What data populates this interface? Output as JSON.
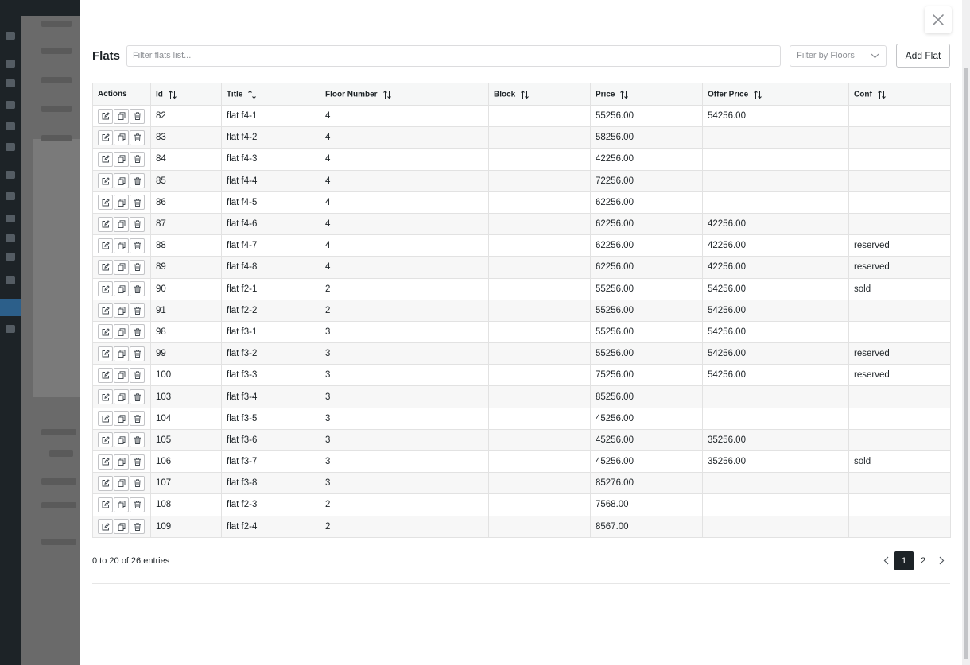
{
  "modal": {
    "title": "Flats",
    "filter_placeholder": "Filter flats list...",
    "floor_filter_label": "Filter by Floors",
    "add_button": "Add Flat"
  },
  "table": {
    "columns": [
      "Actions",
      "Id",
      "Title",
      "Floor Number",
      "Block",
      "Price",
      "Offer Price",
      "Conf"
    ],
    "rows": [
      {
        "id": "82",
        "title": "flat f4-1",
        "floor": "4",
        "block": "",
        "price": "55256.00",
        "offer": "54256.00",
        "conf": ""
      },
      {
        "id": "83",
        "title": "flat f4-2",
        "floor": "4",
        "block": "",
        "price": "58256.00",
        "offer": "",
        "conf": ""
      },
      {
        "id": "84",
        "title": "flat f4-3",
        "floor": "4",
        "block": "",
        "price": "42256.00",
        "offer": "",
        "conf": ""
      },
      {
        "id": "85",
        "title": "flat f4-4",
        "floor": "4",
        "block": "",
        "price": "72256.00",
        "offer": "",
        "conf": ""
      },
      {
        "id": "86",
        "title": "flat f4-5",
        "floor": "4",
        "block": "",
        "price": "62256.00",
        "offer": "",
        "conf": ""
      },
      {
        "id": "87",
        "title": "flat f4-6",
        "floor": "4",
        "block": "",
        "price": "62256.00",
        "offer": "42256.00",
        "conf": ""
      },
      {
        "id": "88",
        "title": "flat f4-7",
        "floor": "4",
        "block": "",
        "price": "62256.00",
        "offer": "42256.00",
        "conf": "reserved"
      },
      {
        "id": "89",
        "title": "flat f4-8",
        "floor": "4",
        "block": "",
        "price": "62256.00",
        "offer": "42256.00",
        "conf": "reserved"
      },
      {
        "id": "90",
        "title": "flat f2-1",
        "floor": "2",
        "block": "",
        "price": "55256.00",
        "offer": "54256.00",
        "conf": "sold"
      },
      {
        "id": "91",
        "title": "flat f2-2",
        "floor": "2",
        "block": "",
        "price": "55256.00",
        "offer": "54256.00",
        "conf": ""
      },
      {
        "id": "98",
        "title": "flat f3-1",
        "floor": "3",
        "block": "",
        "price": "55256.00",
        "offer": "54256.00",
        "conf": ""
      },
      {
        "id": "99",
        "title": "flat f3-2",
        "floor": "3",
        "block": "",
        "price": "55256.00",
        "offer": "54256.00",
        "conf": "reserved"
      },
      {
        "id": "100",
        "title": "flat f3-3",
        "floor": "3",
        "block": "",
        "price": "75256.00",
        "offer": "54256.00",
        "conf": "reserved"
      },
      {
        "id": "103",
        "title": "flat f3-4",
        "floor": "3",
        "block": "",
        "price": "85256.00",
        "offer": "",
        "conf": ""
      },
      {
        "id": "104",
        "title": "flat f3-5",
        "floor": "3",
        "block": "",
        "price": "45256.00",
        "offer": "",
        "conf": ""
      },
      {
        "id": "105",
        "title": "flat f3-6",
        "floor": "3",
        "block": "",
        "price": "45256.00",
        "offer": "35256.00",
        "conf": ""
      },
      {
        "id": "106",
        "title": "flat f3-7",
        "floor": "3",
        "block": "",
        "price": "45256.00",
        "offer": "35256.00",
        "conf": "sold"
      },
      {
        "id": "107",
        "title": "flat f3-8",
        "floor": "3",
        "block": "",
        "price": "85276.00",
        "offer": "",
        "conf": ""
      },
      {
        "id": "108",
        "title": "flat f2-3",
        "floor": "2",
        "block": "",
        "price": "7568.00",
        "offer": "",
        "conf": ""
      },
      {
        "id": "109",
        "title": "flat f2-4",
        "floor": "2",
        "block": "",
        "price": "8567.00",
        "offer": "",
        "conf": ""
      }
    ]
  },
  "footer": {
    "entries_text": "0 to 20 of 26 entries",
    "pages": [
      "1",
      "2"
    ],
    "current_page": "1"
  },
  "icons": {
    "close": "close-icon",
    "dropdown": "chevron-down-icon",
    "sort": "sort-icon",
    "edit": "edit-icon",
    "duplicate": "duplicate-icon",
    "delete": "trash-icon",
    "prev": "chevron-left-icon",
    "next": "chevron-right-icon"
  }
}
